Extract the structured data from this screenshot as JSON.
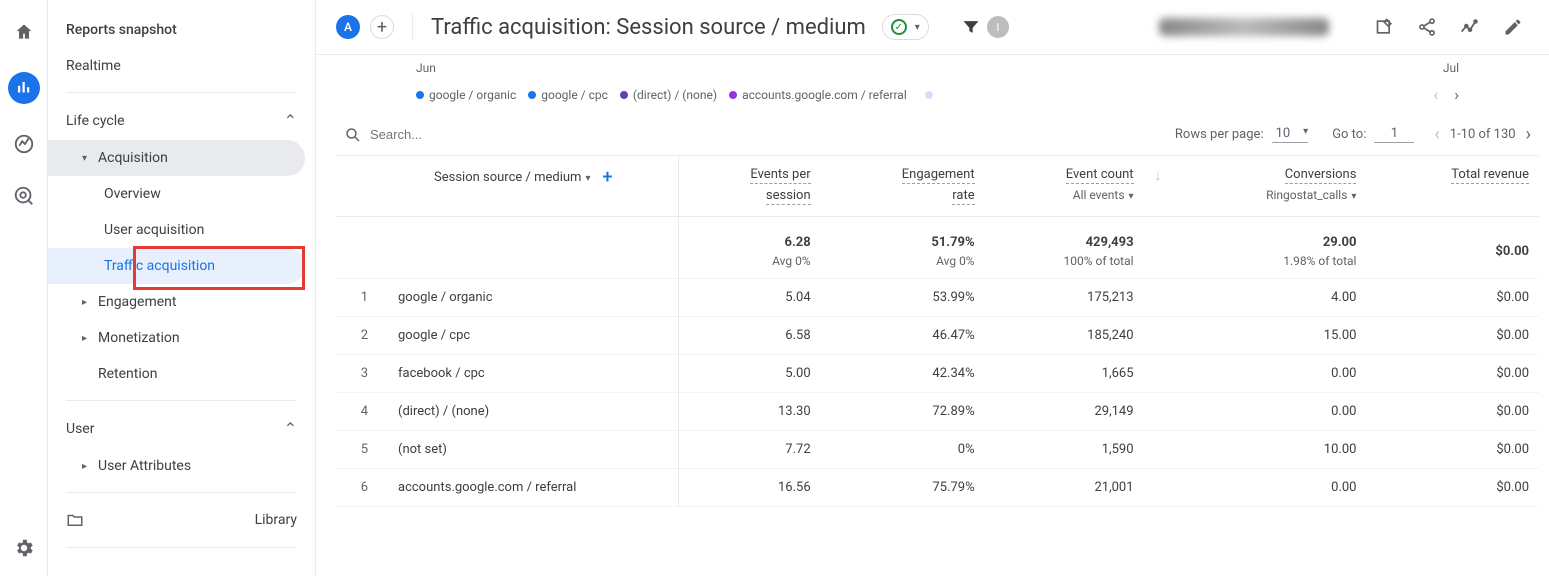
{
  "rail": {},
  "sidebar": {
    "reports_snapshot": "Reports snapshot",
    "realtime": "Realtime",
    "sections": {
      "life_cycle": {
        "label": "Life cycle"
      },
      "user": {
        "label": "User"
      }
    },
    "acquisition": {
      "label": "Acquisition",
      "overview": "Overview",
      "user_acq": "User acquisition",
      "traffic_acq": "Traffic acquisition"
    },
    "engagement": "Engagement",
    "monetization": "Monetization",
    "retention": "Retention",
    "user_attributes": "User Attributes",
    "library": "Library"
  },
  "header": {
    "avatar": "A",
    "title": "Traffic acquisition: Session source / medium"
  },
  "legend": {
    "axis1": "Jun",
    "axis2": "Jul",
    "items": [
      {
        "label": "google / organic",
        "color": "#1a73e8"
      },
      {
        "label": "google / cpc",
        "color": "#1a73e8"
      },
      {
        "label": "(direct) / (none)",
        "color": "#673ab7"
      },
      {
        "label": "accounts.google.com / referral",
        "color": "#9334e6"
      }
    ]
  },
  "table": {
    "search_placeholder": "Search...",
    "rows_per_page_label": "Rows per page:",
    "rows_per_page_value": "10",
    "goto_label": "Go to:",
    "goto_value": "1",
    "range": "1-10 of 130",
    "dimension": "Session source / medium",
    "cols": {
      "events_per_session": {
        "l1": "Events per",
        "l2": "session"
      },
      "engagement_rate": {
        "l1": "Engagement",
        "l2": "rate"
      },
      "event_count": {
        "l1": "Event count",
        "sub": "All events"
      },
      "conversions": {
        "l1": "Conversions",
        "sub": "Ringostat_calls"
      },
      "total_revenue": {
        "l1": "Total revenue"
      }
    },
    "summary": {
      "events_per_session": "6.28",
      "events_per_session_sub": "Avg 0%",
      "engagement_rate": "51.79%",
      "engagement_rate_sub": "Avg 0%",
      "event_count": "429,493",
      "event_count_sub": "100% of total",
      "conversions": "29.00",
      "conversions_sub": "1.98% of total",
      "total_revenue": "$0.00"
    },
    "rows": [
      {
        "idx": "1",
        "dim": "google / organic",
        "eps": "5.04",
        "er": "53.99%",
        "ec": "175,213",
        "cv": "4.00",
        "rev": "$0.00"
      },
      {
        "idx": "2",
        "dim": "google / cpc",
        "eps": "6.58",
        "er": "46.47%",
        "ec": "185,240",
        "cv": "15.00",
        "rev": "$0.00"
      },
      {
        "idx": "3",
        "dim": "facebook / cpc",
        "eps": "5.00",
        "er": "42.34%",
        "ec": "1,665",
        "cv": "0.00",
        "rev": "$0.00"
      },
      {
        "idx": "4",
        "dim": "(direct) / (none)",
        "eps": "13.30",
        "er": "72.89%",
        "ec": "29,149",
        "cv": "0.00",
        "rev": "$0.00"
      },
      {
        "idx": "5",
        "dim": "(not set)",
        "eps": "7.72",
        "er": "0%",
        "ec": "1,590",
        "cv": "10.00",
        "rev": "$0.00"
      },
      {
        "idx": "6",
        "dim": "accounts.google.com / referral",
        "eps": "16.56",
        "er": "75.79%",
        "ec": "21,001",
        "cv": "0.00",
        "rev": "$0.00"
      }
    ]
  }
}
